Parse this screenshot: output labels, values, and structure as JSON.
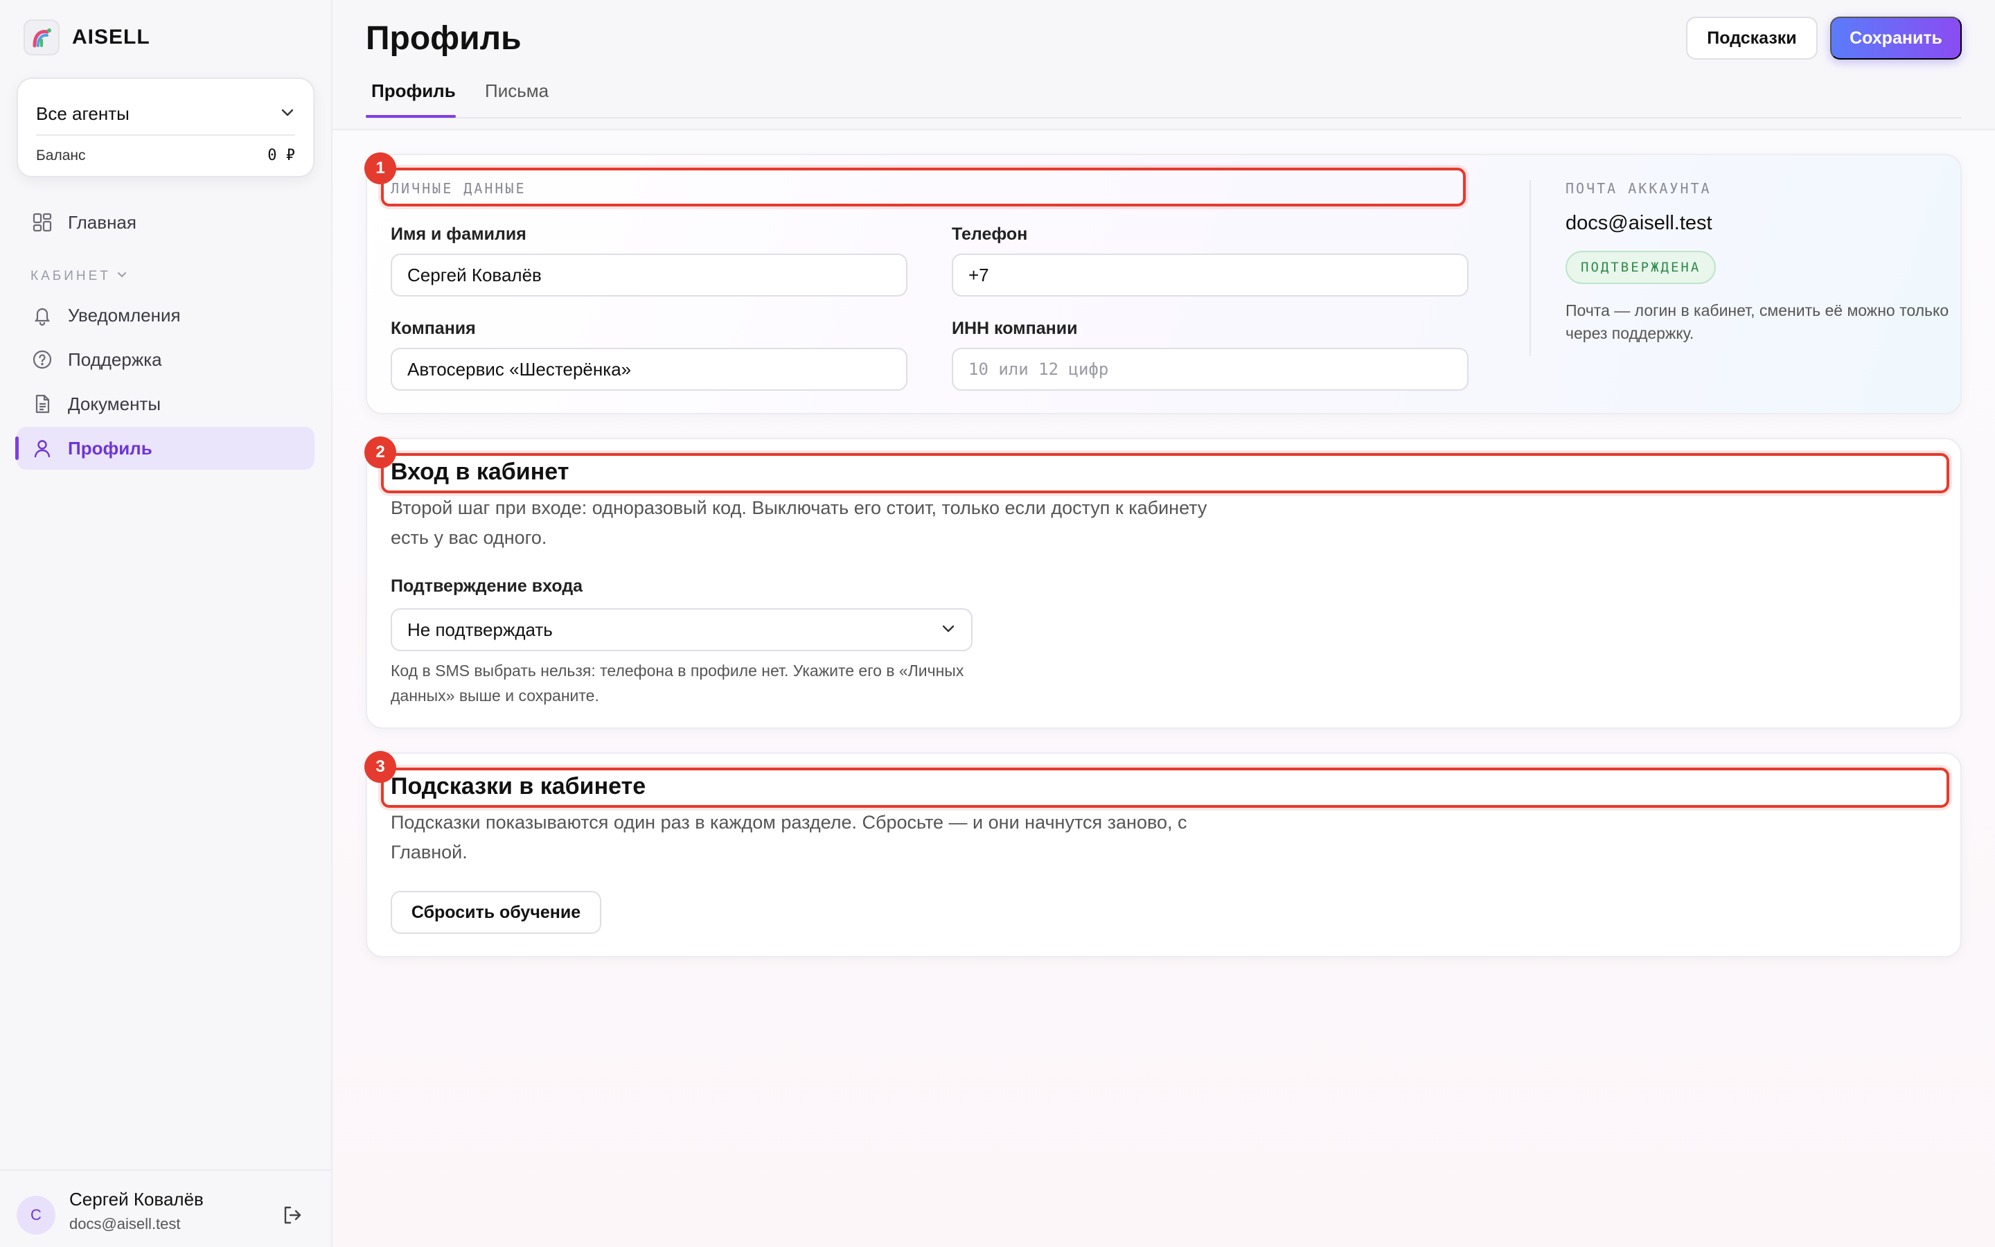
{
  "brand": {
    "name": "AISELL"
  },
  "agent_card": {
    "select_label": "Все агенты",
    "balance_label": "Баланс",
    "balance_value": "0 ₽"
  },
  "sidebar": {
    "main_label": "Главная",
    "section_label": "КАБИНЕТ",
    "items": [
      {
        "label": "Уведомления",
        "icon": "bell-icon"
      },
      {
        "label": "Поддержка",
        "icon": "help-circle-icon"
      },
      {
        "label": "Документы",
        "icon": "document-icon"
      },
      {
        "label": "Профиль",
        "icon": "user-icon",
        "active": true
      }
    ]
  },
  "user": {
    "initial": "С",
    "name": "Сергей Ковалёв",
    "email": "docs@aisell.test"
  },
  "header": {
    "title": "Профиль",
    "hints_button": "Подсказки",
    "save_button": "Сохранить"
  },
  "tabs": [
    {
      "label": "Профиль",
      "active": true
    },
    {
      "label": "Письма",
      "active": false
    }
  ],
  "personal": {
    "badge": "1",
    "eyebrow": "ЛИЧНЫЕ ДАННЫЕ",
    "name_label": "Имя и фамилия",
    "name_value": "Сергей Ковалёв",
    "phone_label": "Телефон",
    "phone_value": "+7",
    "company_label": "Компания",
    "company_value": "Автосервис «Шестерёнка»",
    "inn_label": "ИНН компании",
    "inn_placeholder": "10 или 12 цифр"
  },
  "account_email": {
    "eyebrow": "ПОЧТА АККАУНТА",
    "email": "docs@aisell.test",
    "status": "ПОДТВЕРЖДЕНА",
    "note": "Почта — логин в кабинет, сменить её можно только через поддержку."
  },
  "login": {
    "badge": "2",
    "title": "Вход в кабинет",
    "description": "Второй шаг при входе: одноразовый код. Выключать его стоит, только если доступ к кабинету есть у вас одного.",
    "select_label": "Подтверждение входа",
    "select_value": "Не подтверждать",
    "hint": "Код в SMS выбрать нельзя: телефона в профиле нет. Укажите его в «Личных данных» выше и сохраните."
  },
  "tips": {
    "badge": "3",
    "title": "Подсказки в кабинете",
    "description": "Подсказки показываются один раз в каждом разделе. Сбросьте — и они начнутся заново, с Главной.",
    "reset_button": "Сбросить обучение"
  },
  "colors": {
    "accent": "#7b3fe4",
    "highlight": "#e53b2e",
    "success": "#2e8a4a"
  }
}
